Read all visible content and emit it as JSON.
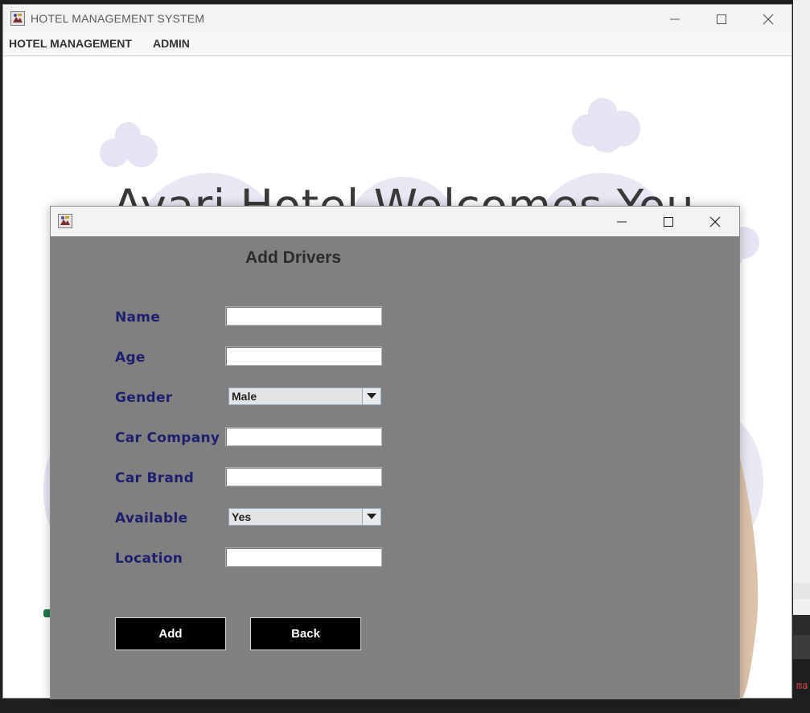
{
  "main_window": {
    "title": "HOTEL MANAGEMENT SYSTEM",
    "menu": [
      {
        "label": "HOTEL MANAGEMENT"
      },
      {
        "label": "ADMIN"
      }
    ],
    "hero_title": "Ayari Hotel Welcomes You"
  },
  "dialog": {
    "title": "",
    "heading": "Add Drivers",
    "fields": {
      "name": {
        "label": "Name",
        "value": ""
      },
      "age": {
        "label": "Age",
        "value": ""
      },
      "gender": {
        "label": "Gender",
        "value": "Male"
      },
      "car_company": {
        "label": "Car Company",
        "value": ""
      },
      "car_brand": {
        "label": "Car Brand",
        "value": ""
      },
      "available": {
        "label": "Available",
        "value": "Yes"
      },
      "location": {
        "label": "Location",
        "value": ""
      }
    },
    "buttons": {
      "add": "Add",
      "back": "Back"
    }
  },
  "colors": {
    "dialog_bg": "#808080",
    "label_color": "#1e1e6e",
    "button_bg": "#000000",
    "illustration_cloud": "#e4e4f2",
    "illustration_figure": "#dcc2a8"
  },
  "icons": [
    "app-icon",
    "minimize-icon",
    "maximize-icon",
    "close-icon",
    "dropdown-arrow-icon"
  ]
}
